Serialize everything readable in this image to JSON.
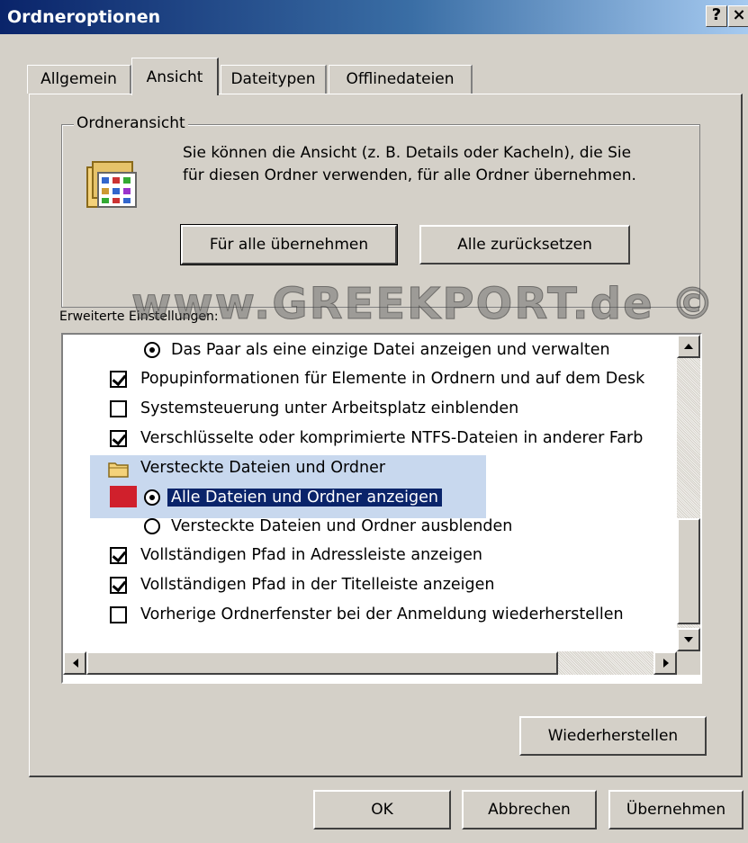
{
  "window": {
    "title": "Ordneroptionen",
    "help_label": "?",
    "close_label": "×",
    "colors": {
      "titlebar_start": "#0a246a",
      "titlebar_end": "#a6caf0",
      "face": "#d4d0c8",
      "selection": "#0a246a",
      "highlight": "#c8d8ee",
      "red_marker": "#d0202c"
    }
  },
  "tabs": [
    {
      "label": "Allgemein",
      "active": false
    },
    {
      "label": "Ansicht",
      "active": true
    },
    {
      "label": "Dateitypen",
      "active": false
    },
    {
      "label": "Offlinedateien",
      "active": false
    }
  ],
  "folder_view": {
    "group_label": "Ordneransicht",
    "icon": "folder-view-icon",
    "description": "Sie können die Ansicht (z. B. Details oder Kacheln), die Sie für diesen Ordner verwenden, für alle Ordner übernehmen.",
    "apply_all_label": "Für alle übernehmen",
    "reset_all_label": "Alle zurücksetzen"
  },
  "advanced": {
    "label": "Erweiterte Einstellungen:",
    "watermark": "www.GREEKPORT.de ©",
    "items": [
      {
        "type": "radio",
        "checked": true,
        "indent": 2,
        "label": "Das Paar als eine einzige Datei anzeigen und verwalten"
      },
      {
        "type": "checkbox",
        "checked": true,
        "indent": 1,
        "label": "Popupinformationen für Elemente in Ordnern und auf dem Desk"
      },
      {
        "type": "checkbox",
        "checked": false,
        "indent": 1,
        "label": "Systemsteuerung unter Arbeitsplatz einblenden"
      },
      {
        "type": "checkbox",
        "checked": true,
        "indent": 1,
        "label": "Verschlüsselte oder komprimierte NTFS-Dateien in anderer Farb"
      },
      {
        "type": "folder",
        "indent": 1,
        "label": "Versteckte Dateien und Ordner"
      },
      {
        "type": "radio",
        "checked": true,
        "indent": 2,
        "selected": true,
        "label": "Alle Dateien und Ordner anzeigen"
      },
      {
        "type": "radio",
        "checked": false,
        "indent": 2,
        "label": "Versteckte Dateien und Ordner ausblenden"
      },
      {
        "type": "checkbox",
        "checked": true,
        "indent": 1,
        "label": "Vollständigen Pfad in Adressleiste anzeigen"
      },
      {
        "type": "checkbox",
        "checked": true,
        "indent": 1,
        "label": "Vollständigen Pfad in der Titelleiste anzeigen"
      },
      {
        "type": "checkbox",
        "checked": false,
        "indent": 1,
        "label": "Vorherige Ordnerfenster bei der Anmeldung wiederherstellen"
      }
    ],
    "restore_label": "Wiederherstellen"
  },
  "footer": {
    "ok_label": "OK",
    "cancel_label": "Abbrechen",
    "apply_label": "Übernehmen"
  }
}
